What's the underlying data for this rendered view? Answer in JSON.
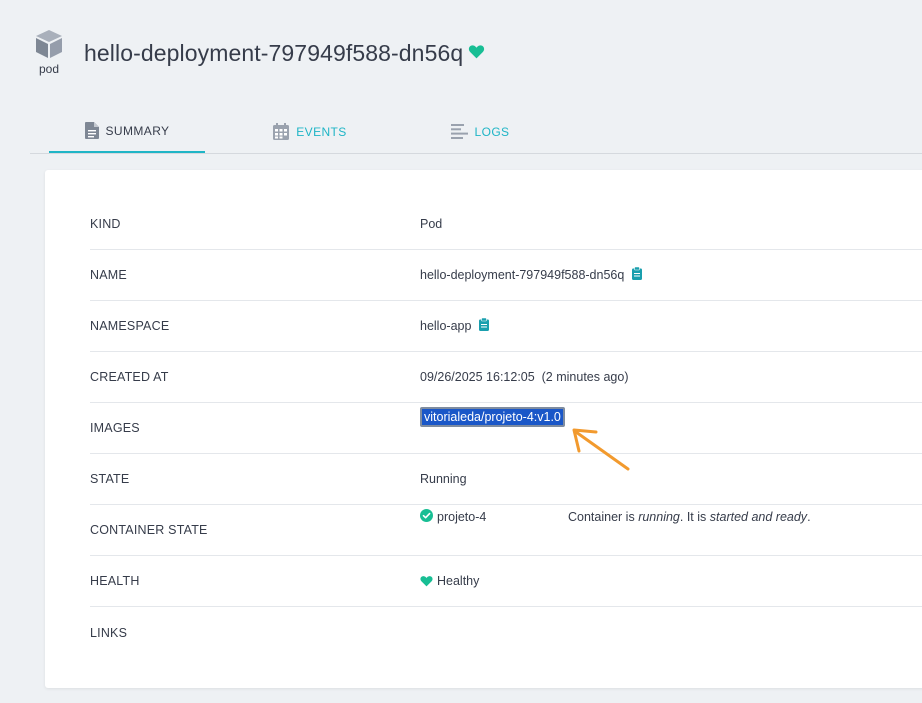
{
  "header": {
    "kind_icon": "cube-icon",
    "kind_label": "pod",
    "title": "hello-deployment-797949f588-dn56q",
    "health_icon": "heart-icon",
    "health_color": "#18be94"
  },
  "tabs": [
    {
      "label": "SUMMARY",
      "icon": "file-icon",
      "active": true
    },
    {
      "label": "EVENTS",
      "icon": "calendar-icon",
      "active": false
    },
    {
      "label": "LOGS",
      "icon": "lines-icon",
      "active": false
    }
  ],
  "summary": {
    "kind": {
      "label": "KIND",
      "value": "Pod"
    },
    "name": {
      "label": "NAME",
      "value": "hello-deployment-797949f588-dn56q"
    },
    "namespace": {
      "label": "NAMESPACE",
      "value": "hello-app"
    },
    "created_at": {
      "label": "CREATED AT",
      "value": "09/26/2025 16:12:05  (2 minutes ago)"
    },
    "images": {
      "label": "IMAGES",
      "value": "vitorialeda/projeto-4:v1.0"
    },
    "state": {
      "label": "STATE",
      "value": "Running"
    },
    "container_state": {
      "label": "CONTAINER STATE",
      "name": "projeto-4",
      "desc_prefix": "Container is ",
      "desc_state": "running",
      "desc_middle": ". It is ",
      "desc_status": "started and ready",
      "desc_suffix": "."
    },
    "health": {
      "label": "HEALTH",
      "value": "Healthy"
    },
    "links": {
      "label": "LINKS",
      "value": ""
    }
  },
  "colors": {
    "accent": "#1fb5c6",
    "healthy": "#18be94",
    "selection": "#1a57c8",
    "annotation_arrow": "#f29a2e"
  }
}
